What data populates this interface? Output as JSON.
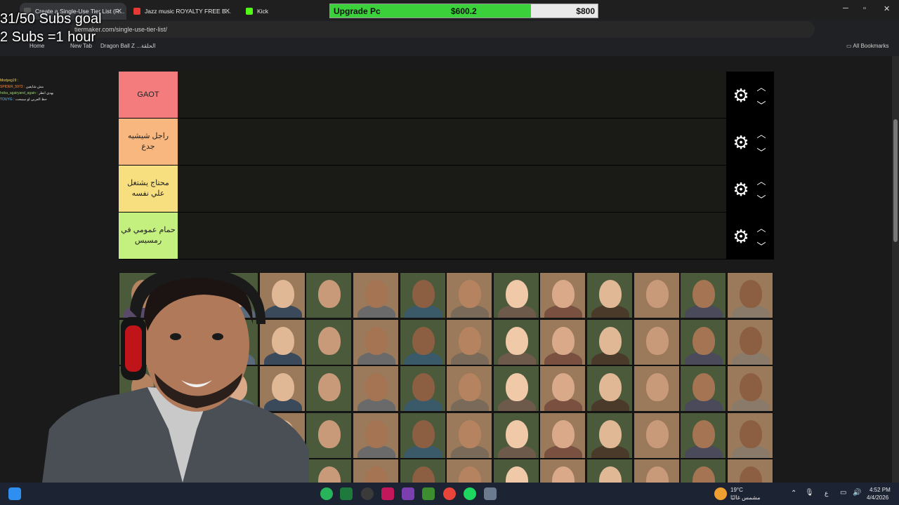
{
  "browser": {
    "tabs": [
      {
        "title": "Create a Single-Use Tier List (R...",
        "active": true
      },
      {
        "title": "Jazz music ROYALTY FREE B...",
        "active": false
      },
      {
        "title": "Kick",
        "active": false
      }
    ],
    "url": "tiermaker.com/single-use-tier-list/",
    "bookmarks": [
      "Home",
      "New Tab",
      "Dragon Ball Z ...الحلقة"
    ],
    "all_bookmarks": "All Bookmarks"
  },
  "upgrade_widget": {
    "label": "Upgrade Pc",
    "current": "$600.2",
    "target": "$800",
    "progress": 0.75
  },
  "stream_overlay": {
    "goal_line1": "31/50 Subs goal",
    "goal_line2": "2 Subs =1 hour",
    "chat": [
      {
        "user": "Modyeg19 :",
        "text": ""
      },
      {
        "user": "SPIDER_5973 :",
        "text": "مش شايفين"
      },
      {
        "user": "hoba_agairyand_again :",
        "text": "بهدي انظر"
      },
      {
        "user": "TOUYG :",
        "text": "حظ العربي لو سمحت"
      }
    ]
  },
  "tiers": [
    {
      "label": "GAOT",
      "color": "#f47c7c"
    },
    {
      "label": "راجل شيشيه جدع",
      "color": "#f7b77f"
    },
    {
      "label": "محتاج يشتغل علي نفسه",
      "color": "#f7df7f"
    },
    {
      "label": "حمام عمومي في رمسيس",
      "color": "#c4f07f"
    }
  ],
  "tier_controls": {
    "settings_icon": "gear-icon",
    "up_icon": "chevron-up-icon",
    "down_icon": "chevron-down-icon"
  },
  "taskbar": {
    "weather_temp": "19°C",
    "weather_desc": "مشمس غالبًا",
    "time": "4:52 PM",
    "date": "4/4/2026",
    "lang": "ع"
  }
}
